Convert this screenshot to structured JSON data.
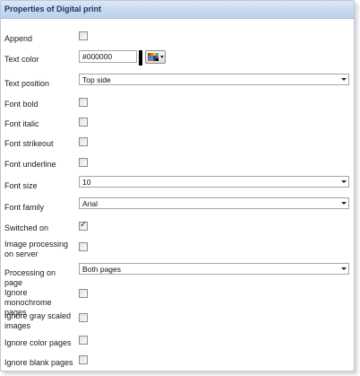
{
  "panel": {
    "title": "Properties of Digital print"
  },
  "colors": {
    "title_text": "#15325f",
    "title_gradient_top": "#dbe7f5",
    "title_gradient_bottom": "#bcd0ea",
    "text_color_swatch": "#000000"
  },
  "fields": {
    "append": {
      "label": "Append",
      "checked": false
    },
    "text_color": {
      "label": "Text color",
      "value": "#000000",
      "picker_icon": "color-palette-icon"
    },
    "text_position": {
      "label": "Text position",
      "value": "Top side"
    },
    "font_bold": {
      "label": "Font bold",
      "checked": false
    },
    "font_italic": {
      "label": "Font italic",
      "checked": false
    },
    "font_strikeout": {
      "label": "Font strikeout",
      "checked": false
    },
    "font_underline": {
      "label": "Font underline",
      "checked": false
    },
    "font_size": {
      "label": "Font size",
      "value": "10"
    },
    "font_family": {
      "label": "Font family",
      "value": "Arial"
    },
    "switched_on": {
      "label": "Switched on",
      "checked": true,
      "check_glyph": "✓"
    },
    "image_processing_on_server": {
      "label": "Image processing on server",
      "checked": false
    },
    "processing_on_page": {
      "label": "Processing on page",
      "value": "Both pages"
    },
    "ignore_monochrome_pages": {
      "label": "Ignore monochrome pages",
      "checked": false
    },
    "ignore_gray_scaled_images": {
      "label": "Ignore gray scaled images",
      "checked": false
    },
    "ignore_color_pages": {
      "label": "Ignore color pages",
      "checked": false
    },
    "ignore_blank_pages": {
      "label": "Ignore blank pages",
      "checked": false
    }
  }
}
